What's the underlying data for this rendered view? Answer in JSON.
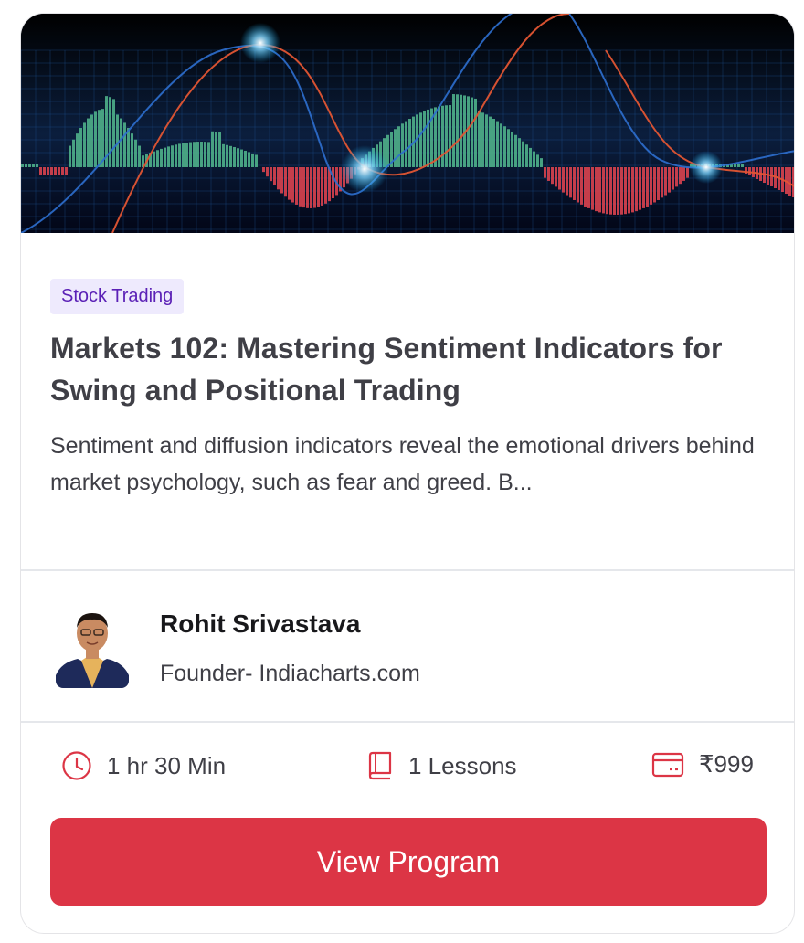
{
  "course": {
    "category": "Stock Trading",
    "title": "Markets 102: Mastering Sentiment Indicators for Swing and Positional Trading",
    "description": "Sentiment and diffusion indicators reveal the emotional drivers behind market psychology, such as fear and greed. B..."
  },
  "instructor": {
    "name": "Rohit Srivastava",
    "role": "Founder- Indiacharts.com"
  },
  "meta": {
    "duration": "1 hr 30 Min",
    "lessons": "1 Lessons",
    "price": "₹999",
    "duration_icon": "clock-icon",
    "lessons_icon": "book-icon",
    "price_icon": "credit-card-icon"
  },
  "cta": {
    "label": "View Program"
  },
  "colors": {
    "accent": "#dc3545",
    "tag_bg": "#eeeafd",
    "tag_text": "#5b21b6",
    "histogram_positive": "#4fb08a",
    "histogram_negative": "#d9434f"
  }
}
